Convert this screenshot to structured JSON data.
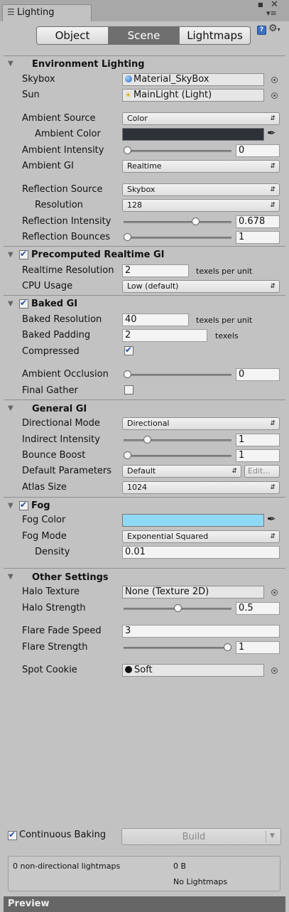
{
  "window": {
    "tab_title": "Lighting"
  },
  "toolbar": {
    "tabs": [
      "Object",
      "Scene",
      "Lightmaps"
    ],
    "active_tab": "Scene"
  },
  "environment": {
    "header": "Environment Lighting",
    "skybox_label": "Skybox",
    "skybox_value": "Material_SkyBox",
    "sun_label": "Sun",
    "sun_value": "MainLight (Light)",
    "ambient_source_label": "Ambient Source",
    "ambient_source_value": "Color",
    "ambient_color_label": "Ambient Color",
    "ambient_color": "#2e3238",
    "ambient_intensity_label": "Ambient Intensity",
    "ambient_intensity_value": "0",
    "ambient_intensity_fraction": 0.0,
    "ambient_gi_label": "Ambient GI",
    "ambient_gi_value": "Realtime",
    "reflection_source_label": "Reflection Source",
    "reflection_source_value": "Skybox",
    "resolution_label": "Resolution",
    "resolution_value": "128",
    "reflection_intensity_label": "Reflection Intensity",
    "reflection_intensity_value": "0.678",
    "reflection_intensity_fraction": 0.678,
    "reflection_bounces_label": "Reflection Bounces",
    "reflection_bounces_value": "1",
    "reflection_bounces_fraction": 0.0
  },
  "precomputed": {
    "header": "Precomputed Realtime GI",
    "enabled": true,
    "realtime_resolution_label": "Realtime Resolution",
    "realtime_resolution_value": "2",
    "realtime_resolution_unit": "texels per unit",
    "cpu_usage_label": "CPU Usage",
    "cpu_usage_value": "Low (default)"
  },
  "baked": {
    "header": "Baked GI",
    "enabled": true,
    "baked_resolution_label": "Baked Resolution",
    "baked_resolution_value": "40",
    "baked_resolution_unit": "texels per unit",
    "baked_padding_label": "Baked Padding",
    "baked_padding_value": "2",
    "baked_padding_unit": "texels",
    "compressed_label": "Compressed",
    "compressed": true,
    "ambient_occlusion_label": "Ambient Occlusion",
    "ambient_occlusion_value": "0",
    "ambient_occlusion_fraction": 0.0,
    "final_gather_label": "Final Gather",
    "final_gather": false
  },
  "general": {
    "header": "General GI",
    "directional_mode_label": "Directional Mode",
    "directional_mode_value": "Directional",
    "indirect_intensity_label": "Indirect Intensity",
    "indirect_intensity_value": "1",
    "indirect_intensity_fraction": 0.2,
    "bounce_boost_label": "Bounce Boost",
    "bounce_boost_value": "1",
    "bounce_boost_fraction": 0.0,
    "default_parameters_label": "Default Parameters",
    "default_parameters_value": "Default",
    "edit_label": "Edit...",
    "atlas_size_label": "Atlas Size",
    "atlas_size_value": "1024"
  },
  "fog": {
    "header": "Fog",
    "enabled": true,
    "fog_color_label": "Fog Color",
    "fog_color": "#8fd9f6",
    "fog_mode_label": "Fog Mode",
    "fog_mode_value": "Exponential Squared",
    "density_label": "Density",
    "density_value": "0.01"
  },
  "other": {
    "header": "Other Settings",
    "halo_texture_label": "Halo Texture",
    "halo_texture_value": "None (Texture 2D)",
    "halo_strength_label": "Halo Strength",
    "halo_strength_value": "0.5",
    "halo_strength_fraction": 0.5,
    "flare_fade_speed_label": "Flare Fade Speed",
    "flare_fade_speed_value": "3",
    "flare_strength_label": "Flare Strength",
    "flare_strength_value": "1",
    "flare_strength_fraction": 1.0,
    "spot_cookie_label": "Spot Cookie",
    "spot_cookie_value": "Soft"
  },
  "footer": {
    "continuous_baking_label": "Continuous Baking",
    "continuous_baking": true,
    "build_label": "Build",
    "lightmap_count_text": "0 non-directional lightmaps",
    "lightmap_size_text": "0 B",
    "no_lightmaps_text": "No Lightmaps",
    "preview_label": "Preview"
  }
}
